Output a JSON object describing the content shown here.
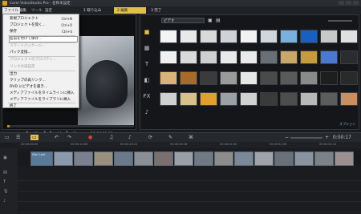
{
  "app": {
    "title": "Corel VideoStudio Pro - 名称未設定"
  },
  "menubar": {
    "file": "ファイル",
    "edit": "編集",
    "tools": "ツール",
    "settings": "設定"
  },
  "steps": [
    {
      "label": "1 取り込み",
      "active": false
    },
    {
      "label": "2 編集",
      "active": true
    },
    {
      "label": "3 完了",
      "active": false
    }
  ],
  "file_menu": {
    "items": [
      {
        "label": "新規プロジェクト",
        "shortcut": "Ctrl+N",
        "disabled": false
      },
      {
        "label": "プロジェクトを開く...",
        "shortcut": "Ctrl+O",
        "disabled": false
      },
      {
        "label": "保存",
        "shortcut": "Ctrl+S",
        "disabled": false
      },
      {
        "label": "名前を付けて保存...",
        "shortcut": "",
        "disabled": false,
        "highlighted": true
      },
      {
        "label": "スマートパッケージ...",
        "shortcut": "",
        "disabled": true
      },
      {
        "label": "パック変換...",
        "shortcut": "",
        "disabled": false
      },
      {
        "label": "プロジェクトのプロパティ...",
        "shortcut": "",
        "disabled": true
      },
      {
        "label": "リンクの再設定",
        "shortcut": "",
        "disabled": true
      },
      {
        "label": "出力",
        "shortcut": "",
        "disabled": false
      },
      {
        "label": "クリップの再リンク...",
        "shortcut": "",
        "disabled": false
      },
      {
        "label": "DVD にビデオを書き...",
        "shortcut": "",
        "disabled": false
      },
      {
        "label": "メディアファイルをタイムラインに挿入",
        "shortcut": "",
        "disabled": false
      },
      {
        "label": "メディアファイルをライブラリに挿入",
        "shortcut": "",
        "disabled": false
      },
      {
        "label": "終了",
        "shortcut": "",
        "disabled": false
      }
    ]
  },
  "preview": {
    "project_label": "Project",
    "clip_label": "Clip",
    "timecode": "00:00:00:00",
    "scrub_progress": 0.02
  },
  "library": {
    "media_type": "ビデオ",
    "link_text": "オプション"
  },
  "timeline": {
    "timecode": "0:00:17",
    "ruler_marks": [
      "00:00:00:00",
      "00:00:10:06",
      "00:00:20:12",
      "00:00:30:18",
      "00:00:41:00",
      "00:00:51:06",
      "00:01:01:12"
    ],
    "first_clip_label": "Clip 1.avi"
  },
  "icons": [
    "undo-icon",
    "redo-icon",
    "record-icon",
    "play-icon",
    "zoom-icon",
    "folder-icon",
    "film-icon",
    "text-icon",
    "fx-icon",
    "music-icon"
  ],
  "colors": {
    "accent": "#e0c04a",
    "bg": "#1a1c1f",
    "menu_bg": "#f1f1f1"
  }
}
